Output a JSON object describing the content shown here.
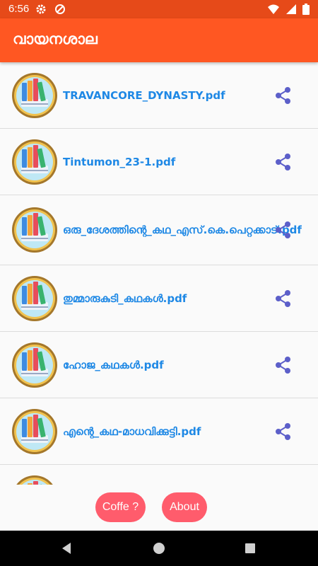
{
  "status_bar": {
    "time": "6:56"
  },
  "app_bar": {
    "title": "വായനശാല"
  },
  "files": [
    {
      "name": "TRAVANCORE_DYNASTY.pdf"
    },
    {
      "name": "Tintumon_23-1.pdf"
    },
    {
      "name": "ഒരു_ദേശത്തിന്റെ_കഥ_എസ്.കെ.പെറ്റക്കാട്.pdf"
    },
    {
      "name": "തുമ്മാരുകുടി_കഥകൾ.pdf"
    },
    {
      "name": "ഹോജ_കഥകൾ.pdf"
    },
    {
      "name": "എന്റെ_കഥ-മാധവിക്കുട്ടി.pdf"
    },
    {
      "name": ""
    }
  ],
  "buttons": {
    "coffee": "Coffe ?",
    "about": "About"
  },
  "colors": {
    "status_bar": "#e64a19",
    "app_bar": "#ff5722",
    "file_name": "#1e88e5",
    "share_icon": "#5c5fc9",
    "pill_button": "#ff5c6c"
  }
}
